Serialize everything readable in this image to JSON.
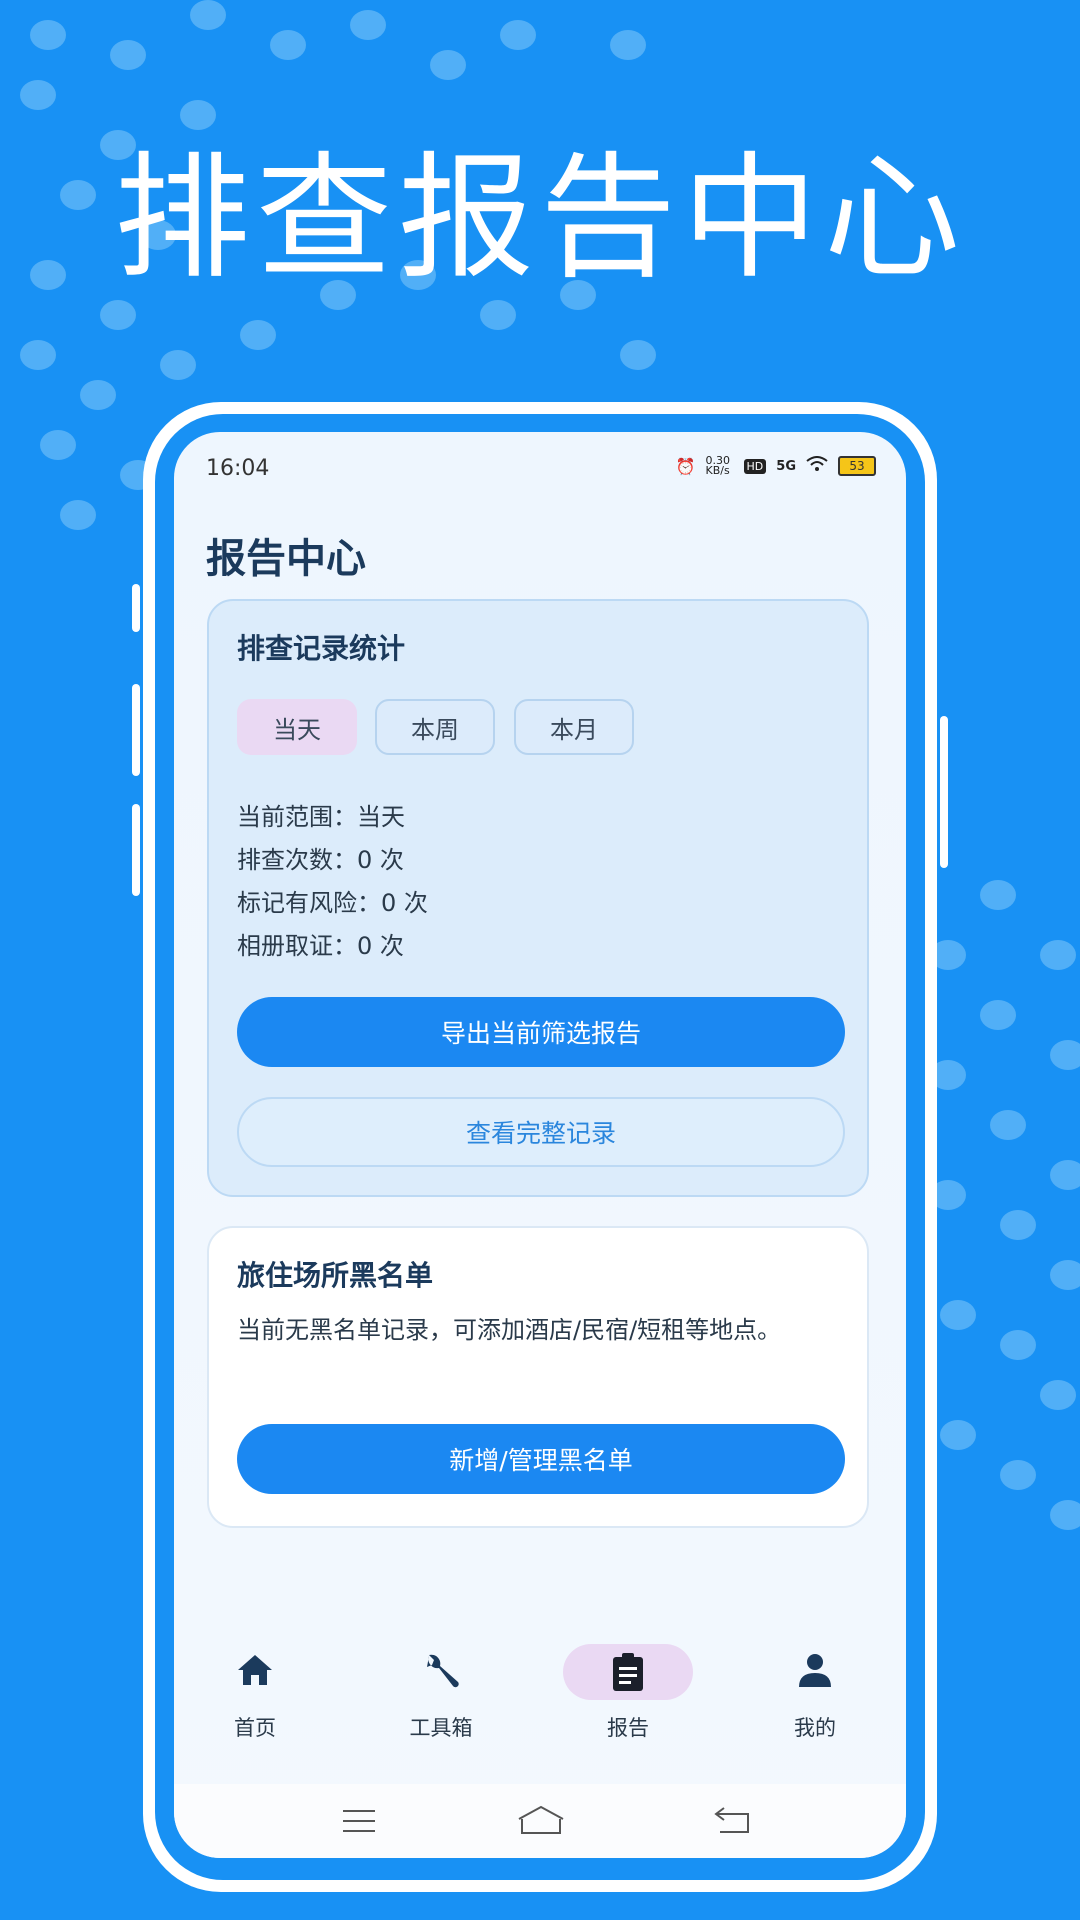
{
  "headline": "排查报告中心",
  "status_bar": {
    "time": "16:04",
    "net_speed": "0.30 KB/s",
    "hd": "HD",
    "network": "5G",
    "battery": "53"
  },
  "page_title": "报告中心",
  "stats_card": {
    "title": "排查记录统计",
    "segments": [
      "当天",
      "本周",
      "本月"
    ],
    "selected_segment": "当天",
    "lines": [
      "当前范围：当天",
      "排查次数：0 次",
      "标记有风险：0 次",
      "相册取证：0 次"
    ],
    "export_button": "导出当前筛选报告",
    "view_button": "查看完整记录"
  },
  "blacklist_card": {
    "title": "旅住场所黑名单",
    "description": "当前无黑名单记录，可添加酒店/民宿/短租等地点。",
    "manage_button": "新增/管理黑名单"
  },
  "bottom_nav": {
    "items": [
      {
        "label": "首页",
        "icon": "home-icon"
      },
      {
        "label": "工具箱",
        "icon": "wrench-icon"
      },
      {
        "label": "报告",
        "icon": "clipboard-icon"
      },
      {
        "label": "我的",
        "icon": "person-icon"
      }
    ],
    "active": "报告"
  },
  "colors": {
    "background": "#1891f4",
    "primary": "#1b88f2",
    "title_text": "#1b3a5c",
    "active_pill": "#ead9f3"
  }
}
